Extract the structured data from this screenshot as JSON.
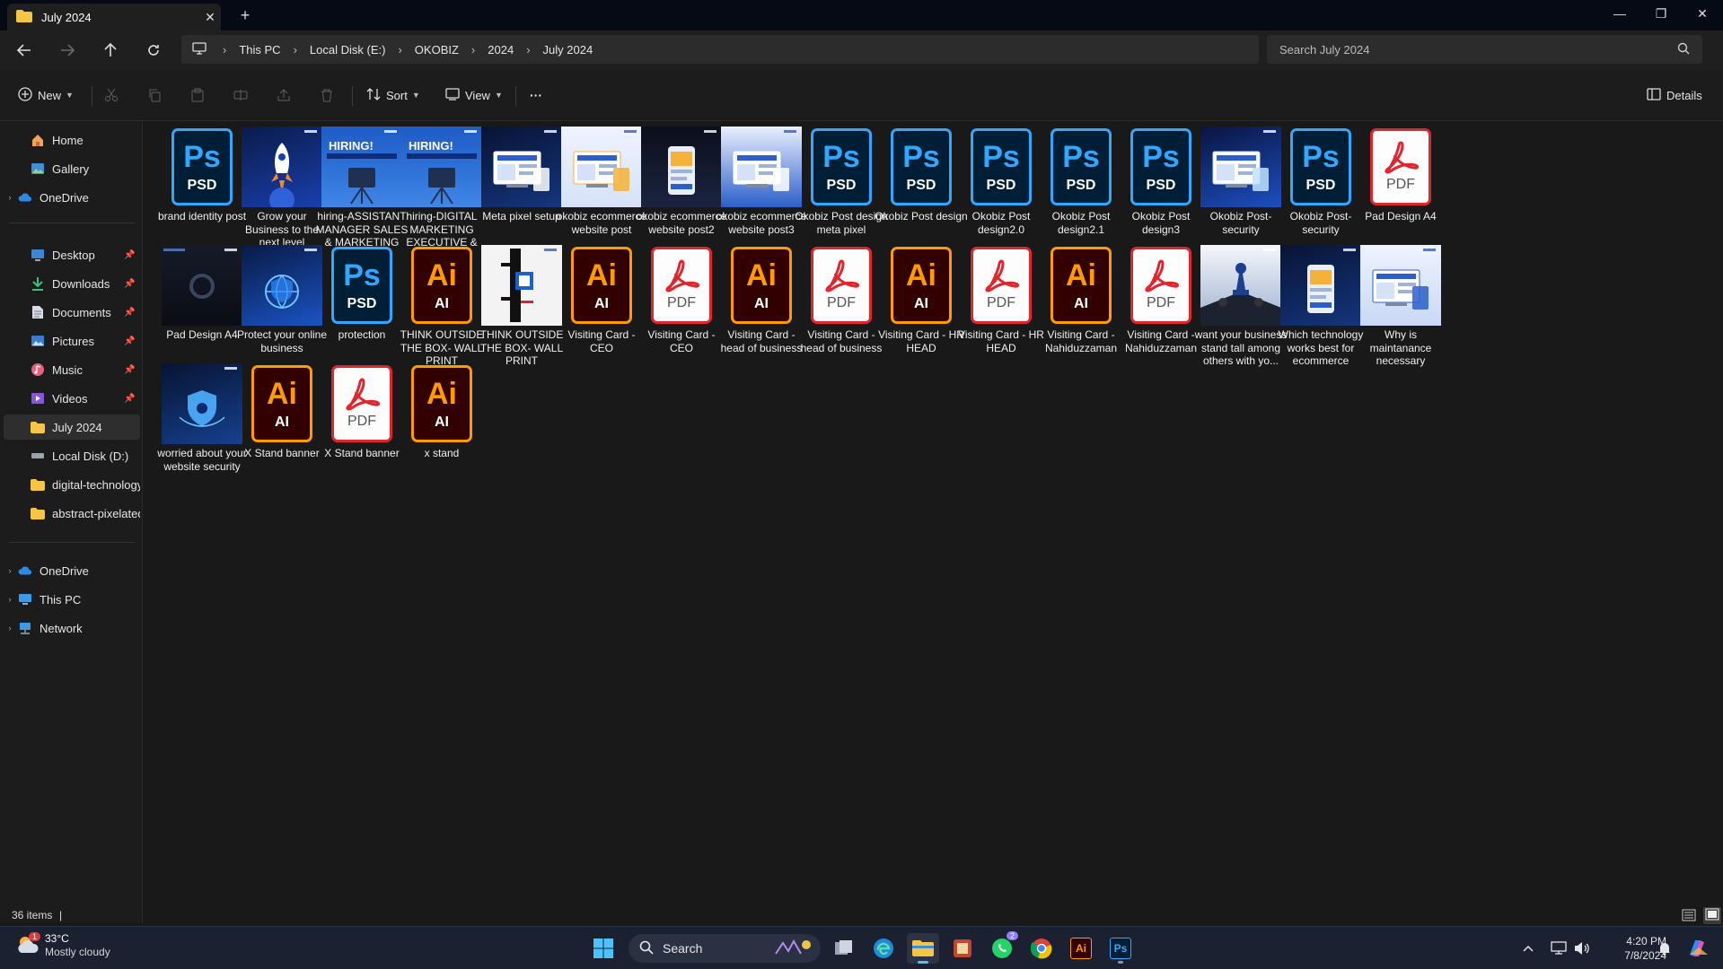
{
  "window": {
    "tab_title": "July 2024",
    "tab_close": "✕",
    "new_tab": "+",
    "minimize": "—",
    "maximize": "❐",
    "close": "✕"
  },
  "address": {
    "crumbs": [
      "This PC",
      "Local Disk (E:)",
      "OKOBIZ",
      "2024",
      "July 2024"
    ],
    "search_placeholder": "Search July 2024"
  },
  "commands": {
    "new": "New",
    "sort": "Sort",
    "view": "View",
    "more": "···",
    "details": "Details"
  },
  "sidebar": {
    "quick": [
      "Home",
      "Gallery",
      "OneDrive"
    ],
    "pinned": [
      "Desktop",
      "Downloads",
      "Documents",
      "Pictures",
      "Music",
      "Videos"
    ],
    "recent": [
      "July 2024",
      "Local Disk (D:)",
      "digital-technology-",
      "abstract-pixelated-"
    ],
    "tree": [
      "OneDrive",
      "This PC",
      "Network"
    ]
  },
  "files": [
    {
      "name": "brand identity post",
      "type": "psd"
    },
    {
      "name": "Grow your Business to the next level",
      "type": "img"
    },
    {
      "name": "hiring-ASSISTANT MANAGER SALES & MARKETING",
      "type": "img"
    },
    {
      "name": "hiring-DIGITAL MARKETING EXECUTIVE & SALES",
      "type": "img"
    },
    {
      "name": "Meta pixel setup",
      "type": "img"
    },
    {
      "name": "okobiz ecommerce website post",
      "type": "img"
    },
    {
      "name": "okobiz ecommerce website post2",
      "type": "img"
    },
    {
      "name": "okobiz ecommerce website post3",
      "type": "img"
    },
    {
      "name": "Okobiz Post design meta pixel",
      "type": "psd"
    },
    {
      "name": "Okobiz Post design",
      "type": "psd"
    },
    {
      "name": "Okobiz Post design2.0",
      "type": "psd"
    },
    {
      "name": "Okobiz Post design2.1",
      "type": "psd"
    },
    {
      "name": "Okobiz Post design3",
      "type": "psd"
    },
    {
      "name": "Okobiz Post-security",
      "type": "img"
    },
    {
      "name": "Okobiz Post-security",
      "type": "psd"
    },
    {
      "name": "Pad Design A4",
      "type": "pdf"
    },
    {
      "name": "Pad Design A4",
      "type": "img"
    },
    {
      "name": "Protect your online business",
      "type": "img"
    },
    {
      "name": "protection",
      "type": "psd"
    },
    {
      "name": "THINK OUTSIDE THE BOX- WALL PRINT",
      "type": "ai"
    },
    {
      "name": "THINK OUTSIDE THE BOX- WALL PRINT",
      "type": "img"
    },
    {
      "name": "Visiting Card - CEO",
      "type": "ai"
    },
    {
      "name": "Visiting Card - CEO",
      "type": "pdf"
    },
    {
      "name": "Visiting Card - head of business",
      "type": "ai"
    },
    {
      "name": "Visiting Card - head of business",
      "type": "pdf"
    },
    {
      "name": "Visiting Card - HR HEAD",
      "type": "ai"
    },
    {
      "name": "Visiting Card - HR HEAD",
      "type": "pdf"
    },
    {
      "name": "Visiting Card - Nahiduzzaman",
      "type": "ai"
    },
    {
      "name": "Visiting Card - Nahiduzzaman",
      "type": "pdf"
    },
    {
      "name": "want your business stand tall among others with yo...",
      "type": "img"
    },
    {
      "name": "Which technology works best for ecommerce",
      "type": "img"
    },
    {
      "name": "Why is maintanance necessary",
      "type": "img"
    },
    {
      "name": "worried about your website security",
      "type": "img"
    },
    {
      "name": "X Stand banner",
      "type": "ai"
    },
    {
      "name": "X Stand banner",
      "type": "pdf"
    },
    {
      "name": "x stand",
      "type": "ai"
    }
  ],
  "icon_text": {
    "psd_big": "Ps",
    "psd_ext": "PSD",
    "ai_big": "Ai",
    "ai_ext": "AI",
    "pdf_ext": "PDF"
  },
  "status": {
    "items": "36 items",
    "cursor": "|"
  },
  "taskbar": {
    "temperature": "33°C",
    "condition": "Mostly cloudy",
    "weather_badge": "1",
    "search": "Search",
    "whatsapp_badge": "2",
    "ai_label": "Ai",
    "ps_label": "Ps",
    "time": "4:20 PM",
    "date": "7/8/2024"
  }
}
